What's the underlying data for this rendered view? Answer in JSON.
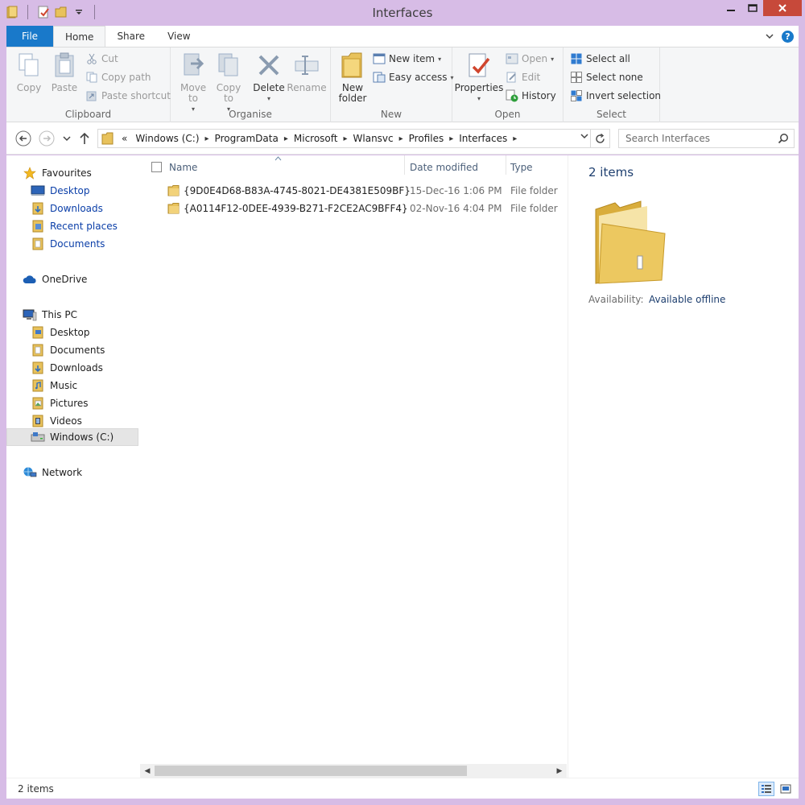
{
  "window": {
    "title": "Interfaces"
  },
  "ribbon": {
    "tabs": [
      {
        "label": "File"
      },
      {
        "label": "Home"
      },
      {
        "label": "Share"
      },
      {
        "label": "View"
      }
    ],
    "groups": {
      "clipboard": {
        "label": "Clipboard",
        "copy": "Copy",
        "paste": "Paste",
        "cut": "Cut",
        "copy_path": "Copy path",
        "paste_shortcut": "Paste shortcut"
      },
      "organise": {
        "label": "Organise",
        "move_to": "Move to",
        "copy_to": "Copy to",
        "delete": "Delete",
        "rename": "Rename"
      },
      "new": {
        "label": "New",
        "new_folder": "New folder",
        "new_item": "New item",
        "easy_access": "Easy access"
      },
      "open": {
        "label": "Open",
        "properties": "Properties",
        "open": "Open",
        "edit": "Edit",
        "history": "History"
      },
      "select": {
        "label": "Select",
        "select_all": "Select all",
        "select_none": "Select none",
        "invert_selection": "Invert selection"
      }
    }
  },
  "address": {
    "overflow": "«",
    "crumbs": [
      "Windows (C:)",
      "ProgramData",
      "Microsoft",
      "Wlansvc",
      "Profiles",
      "Interfaces"
    ]
  },
  "search": {
    "placeholder": "Search Interfaces"
  },
  "nav": {
    "favourites": {
      "label": "Favourites",
      "items": [
        "Desktop",
        "Downloads",
        "Recent places",
        "Documents"
      ]
    },
    "onedrive": "OneDrive",
    "this_pc": {
      "label": "This PC",
      "items": [
        "Desktop",
        "Documents",
        "Downloads",
        "Music",
        "Pictures",
        "Videos",
        "Windows (C:)"
      ]
    },
    "network": "Network"
  },
  "list": {
    "columns": {
      "name": "Name",
      "date": "Date modified",
      "type": "Type"
    },
    "rows": [
      {
        "name": "{9D0E4D68-B83A-4745-8021-DE4381E509BF}",
        "date": "15-Dec-16 1:06 PM",
        "type": "File folder"
      },
      {
        "name": "{A0114F12-0DEE-4939-B271-F2CE2AC9BFF4}",
        "date": "02-Nov-16 4:04 PM",
        "type": "File folder"
      }
    ]
  },
  "details": {
    "count": "2 items",
    "availability_label": "Availability:",
    "availability_value": "Available offline"
  },
  "status": {
    "text": "2 items"
  },
  "colors": {
    "accent": "#1979ca",
    "folder": "#e8c25c",
    "title_bar": "#d7bce6",
    "link": "#0a3ea8"
  }
}
